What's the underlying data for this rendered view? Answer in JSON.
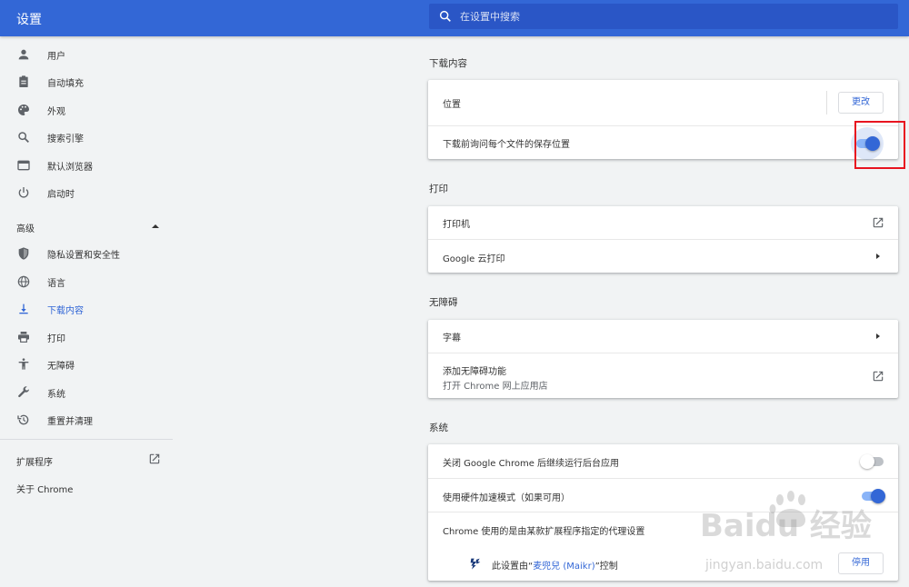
{
  "header": {
    "title": "设置"
  },
  "search": {
    "placeholder": "在设置中搜索"
  },
  "sidebar": {
    "items": [
      {
        "label": "用户",
        "icon": "person-icon"
      },
      {
        "label": "自动填充",
        "icon": "clipboard-icon"
      },
      {
        "label": "外观",
        "icon": "palette-icon"
      },
      {
        "label": "搜索引擎",
        "icon": "search-icon"
      },
      {
        "label": "默认浏览器",
        "icon": "browser-icon"
      },
      {
        "label": "启动时",
        "icon": "power-icon"
      }
    ],
    "advanced": {
      "label": "高级"
    },
    "advanced_items": [
      {
        "label": "隐私设置和安全性",
        "icon": "shield-icon"
      },
      {
        "label": "语言",
        "icon": "globe-icon"
      },
      {
        "label": "下载内容",
        "icon": "download-icon",
        "active": true
      },
      {
        "label": "打印",
        "icon": "printer-icon"
      },
      {
        "label": "无障碍",
        "icon": "accessibility-icon"
      },
      {
        "label": "系统",
        "icon": "wrench-icon"
      },
      {
        "label": "重置并清理",
        "icon": "history-icon"
      }
    ],
    "extensions": "扩展程序",
    "about": "关于 Chrome"
  },
  "downloads": {
    "title": "下载内容",
    "location_label": "位置",
    "change_button": "更改",
    "ask_label": "下载前询问每个文件的保存位置",
    "ask_enabled": true
  },
  "printing": {
    "title": "打印",
    "printers_label": "打印机",
    "cloud_print_label": "Google 云打印"
  },
  "accessibility": {
    "title": "无障碍",
    "captions_label": "字幕",
    "add_features_label": "添加无障碍功能",
    "add_features_sub": "打开 Chrome 网上应用店"
  },
  "system": {
    "title": "系统",
    "background_label": "关闭 Google Chrome 后继续运行后台应用",
    "background_enabled": false,
    "hw_accel_label": "使用硬件加速模式（如果可用）",
    "hw_accel_enabled": true,
    "proxy_label": "Chrome 使用的是由某款扩展程序指定的代理设置",
    "controlled_prefix": "此设置由“",
    "controlled_ext": "麦兜兒 (Maikr)",
    "controlled_suffix": "”控制",
    "disable_button": "停用"
  },
  "watermark": {
    "text": "Baidu 经验",
    "sub": "jingyan.baidu.com"
  },
  "colors": {
    "brand": "#3367d6",
    "highlight": "#e8141f"
  }
}
